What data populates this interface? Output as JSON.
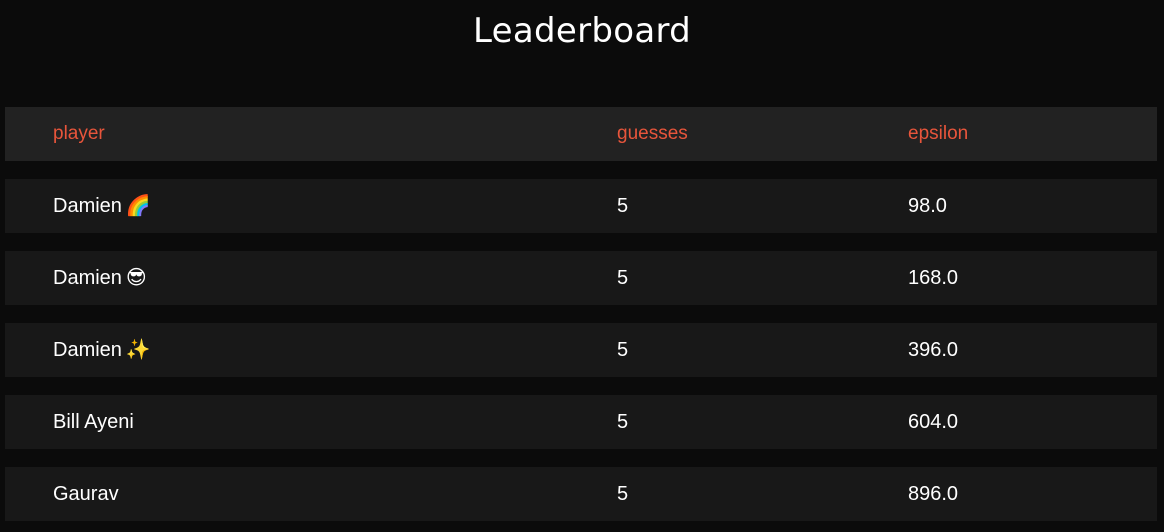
{
  "page": {
    "title": "Leaderboard"
  },
  "table": {
    "columns": [
      "player",
      "guesses",
      "epsilon"
    ],
    "rows": [
      {
        "player": "Damien",
        "emoji": "🌈",
        "guesses": "5",
        "epsilon": "98.0"
      },
      {
        "player": "Damien",
        "emoji": "😎",
        "guesses": "5",
        "epsilon": "168.0"
      },
      {
        "player": "Damien",
        "emoji": "✨",
        "guesses": "5",
        "epsilon": "396.0"
      },
      {
        "player": "Bill Ayeni",
        "emoji": "",
        "guesses": "5",
        "epsilon": "604.0"
      },
      {
        "player": "Gaurav",
        "emoji": "",
        "guesses": "5",
        "epsilon": "896.0"
      }
    ]
  },
  "colors": {
    "background": "#0b0b0b",
    "header_row": "#222222",
    "data_row": "#181818",
    "header_text": "#e8553b",
    "text": "#ffffff"
  }
}
